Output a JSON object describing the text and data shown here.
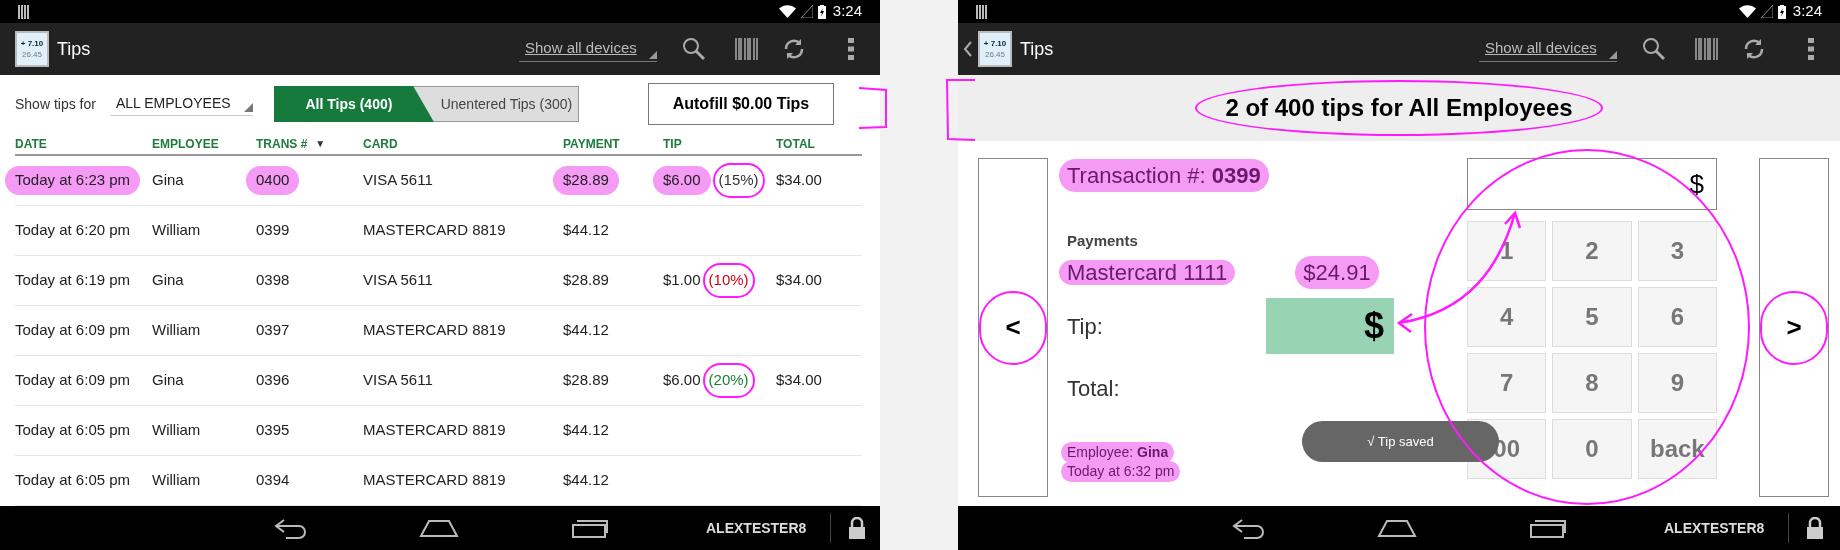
{
  "left_screen": {
    "status_bar": {
      "time": "3:24"
    },
    "action_bar": {
      "up_navigation": false,
      "app_icon": [
        "+ 7.10",
        "26.45"
      ],
      "title": "Tips",
      "device_filter": "Show all devices"
    },
    "filter_bar": {
      "label": "Show tips for",
      "employee_filter": "ALL EMPLOYEES",
      "tabs": [
        {
          "label": "All Tips (400)",
          "selected": true
        },
        {
          "label": "Unentered Tips (300)",
          "selected": false
        }
      ],
      "autofill_button": "Autofill $0.00 Tips"
    },
    "table": {
      "columns": [
        {
          "label": "DATE"
        },
        {
          "label": "EMPLOYEE"
        },
        {
          "label": "TRANS #",
          "sort_indicator": "▼"
        },
        {
          "label": "CARD"
        },
        {
          "label": "PAYMENT"
        },
        {
          "label": "TIP"
        },
        {
          "label": "TOTAL"
        }
      ],
      "rows": [
        {
          "highlighted": true,
          "date": "Today at 6:23 pm",
          "employee": "Gina",
          "trans": "0400",
          "card": "VISA 5611",
          "payment": "$28.89",
          "tip": "$6.00",
          "tip_percent": {
            "text": "(15%)",
            "color": "#333333",
            "circled": true
          },
          "total": "$34.00"
        },
        {
          "highlighted": false,
          "date": "Today at 6:20 pm",
          "employee": "William",
          "trans": "0399",
          "card": "MASTERCARD 8819",
          "payment": "$44.12"
        },
        {
          "highlighted": false,
          "date": "Today at 6:19 pm",
          "employee": "Gina",
          "trans": "0398",
          "card": "VISA 5611",
          "payment": "$28.89",
          "tip": "$1.00",
          "tip_percent": {
            "text": "(10%)",
            "color": "#d0021b",
            "circled": true
          },
          "total": "$34.00"
        },
        {
          "highlighted": false,
          "date": "Today at 6:09 pm",
          "employee": "William",
          "trans": "0397",
          "card": "MASTERCARD 8819",
          "payment": "$44.12"
        },
        {
          "highlighted": false,
          "date": "Today at 6:09 pm",
          "employee": "Gina",
          "trans": "0396",
          "card": "VISA 5611",
          "payment": "$28.89",
          "tip": "$6.00",
          "tip_percent": {
            "text": "(20%)",
            "color": "#1a7f37",
            "circled": true
          },
          "total": "$34.00"
        },
        {
          "highlighted": false,
          "date": "Today at 6:05 pm",
          "employee": "William",
          "trans": "0395",
          "card": "MASTERCARD 8819",
          "payment": "$44.12"
        },
        {
          "highlighted": false,
          "date": "Today at 6:05 pm",
          "employee": "William",
          "trans": "0394",
          "card": "MASTERCARD 8819",
          "payment": "$44.12"
        }
      ]
    },
    "nav_bar": {
      "user": "ALEXTESTER8"
    }
  },
  "right_screen": {
    "status_bar": {
      "time": "3:24"
    },
    "action_bar": {
      "up_navigation": true,
      "app_icon": [
        "+ 7.10",
        "26.45"
      ],
      "title": "Tips",
      "device_filter": "Show all devices"
    },
    "summary": {
      "text": "2 of 400 tips for All Employees",
      "circled": true
    },
    "prev_button": {
      "label": "<",
      "circled": true
    },
    "next_button": {
      "label": ">",
      "circled": true
    },
    "transaction": {
      "text": "Transaction #: **0399**",
      "highlighted": true
    },
    "payments_heading": "Payments",
    "payments": [
      {
        "card": "Mastercard 1111",
        "amount": "$24.91",
        "highlighted": true
      }
    ],
    "tip_label": "Tip:",
    "tip_field": {
      "value": "$"
    },
    "total_label": "Total:",
    "employee": {
      "text": "Employee: **Gina**",
      "highlighted": true
    },
    "time": {
      "text": "Today at 6:32 pm",
      "highlighted": true
    },
    "toast": "√ Tip saved",
    "amount_field": {
      "value": "$"
    },
    "keypad": [
      "1",
      "2",
      "3",
      "4",
      "5",
      "6",
      "7",
      "8",
      "9",
      "00",
      "0",
      "back"
    ],
    "nav_bar": {
      "user": "ALEXTESTER8"
    }
  }
}
